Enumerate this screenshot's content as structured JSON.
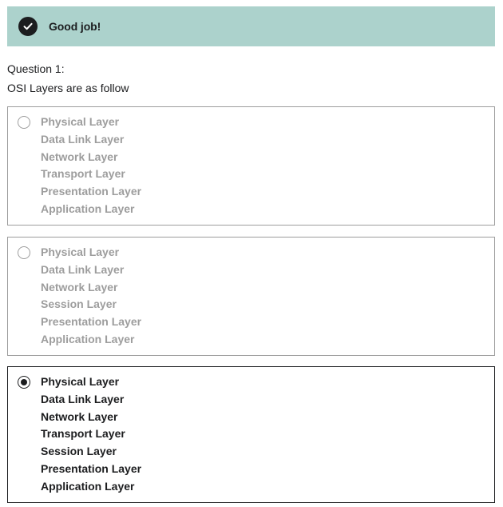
{
  "feedback": {
    "message": "Good job!",
    "icon": "check-circle-icon",
    "background": "#acd2cc"
  },
  "question": {
    "number_label": "Question 1:",
    "text": "OSI Layers are as follow"
  },
  "options": [
    {
      "selected": false,
      "lines": [
        "Physical Layer",
        "Data Link Layer",
        "Network Layer",
        "Transport Layer",
        "Presentation Layer",
        "Application Layer"
      ]
    },
    {
      "selected": false,
      "lines": [
        "Physical Layer",
        "Data Link Layer",
        "Network Layer",
        "Session Layer",
        "Presentation Layer",
        "Application Layer"
      ]
    },
    {
      "selected": true,
      "lines": [
        "Physical Layer",
        "Data Link Layer",
        "Network Layer",
        "Transport Layer",
        "Session Layer",
        "Presentation Layer",
        "Application Layer"
      ]
    }
  ],
  "colors": {
    "text": "#1c1d1f",
    "muted": "#9d9d9d"
  }
}
